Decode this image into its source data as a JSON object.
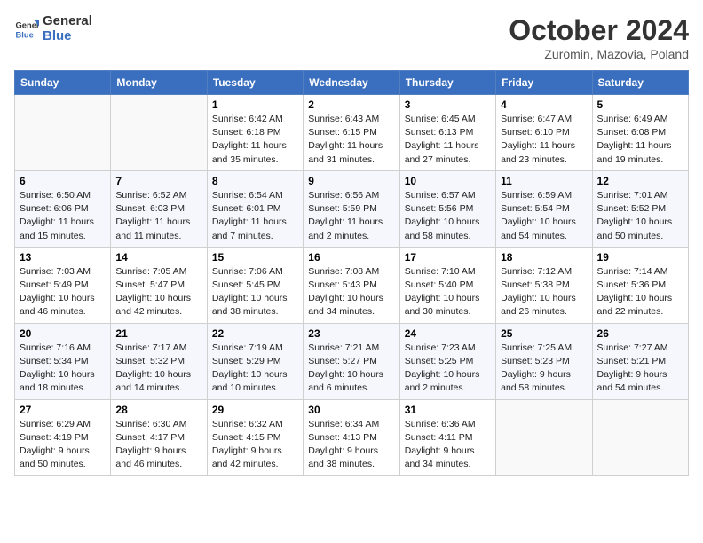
{
  "logo": {
    "line1": "General",
    "line2": "Blue"
  },
  "title": "October 2024",
  "location": "Zuromin, Mazovia, Poland",
  "headers": [
    "Sunday",
    "Monday",
    "Tuesday",
    "Wednesday",
    "Thursday",
    "Friday",
    "Saturday"
  ],
  "weeks": [
    [
      {
        "day": "",
        "info": ""
      },
      {
        "day": "",
        "info": ""
      },
      {
        "day": "1",
        "info": "Sunrise: 6:42 AM\nSunset: 6:18 PM\nDaylight: 11 hours and 35 minutes."
      },
      {
        "day": "2",
        "info": "Sunrise: 6:43 AM\nSunset: 6:15 PM\nDaylight: 11 hours and 31 minutes."
      },
      {
        "day": "3",
        "info": "Sunrise: 6:45 AM\nSunset: 6:13 PM\nDaylight: 11 hours and 27 minutes."
      },
      {
        "day": "4",
        "info": "Sunrise: 6:47 AM\nSunset: 6:10 PM\nDaylight: 11 hours and 23 minutes."
      },
      {
        "day": "5",
        "info": "Sunrise: 6:49 AM\nSunset: 6:08 PM\nDaylight: 11 hours and 19 minutes."
      }
    ],
    [
      {
        "day": "6",
        "info": "Sunrise: 6:50 AM\nSunset: 6:06 PM\nDaylight: 11 hours and 15 minutes."
      },
      {
        "day": "7",
        "info": "Sunrise: 6:52 AM\nSunset: 6:03 PM\nDaylight: 11 hours and 11 minutes."
      },
      {
        "day": "8",
        "info": "Sunrise: 6:54 AM\nSunset: 6:01 PM\nDaylight: 11 hours and 7 minutes."
      },
      {
        "day": "9",
        "info": "Sunrise: 6:56 AM\nSunset: 5:59 PM\nDaylight: 11 hours and 2 minutes."
      },
      {
        "day": "10",
        "info": "Sunrise: 6:57 AM\nSunset: 5:56 PM\nDaylight: 10 hours and 58 minutes."
      },
      {
        "day": "11",
        "info": "Sunrise: 6:59 AM\nSunset: 5:54 PM\nDaylight: 10 hours and 54 minutes."
      },
      {
        "day": "12",
        "info": "Sunrise: 7:01 AM\nSunset: 5:52 PM\nDaylight: 10 hours and 50 minutes."
      }
    ],
    [
      {
        "day": "13",
        "info": "Sunrise: 7:03 AM\nSunset: 5:49 PM\nDaylight: 10 hours and 46 minutes."
      },
      {
        "day": "14",
        "info": "Sunrise: 7:05 AM\nSunset: 5:47 PM\nDaylight: 10 hours and 42 minutes."
      },
      {
        "day": "15",
        "info": "Sunrise: 7:06 AM\nSunset: 5:45 PM\nDaylight: 10 hours and 38 minutes."
      },
      {
        "day": "16",
        "info": "Sunrise: 7:08 AM\nSunset: 5:43 PM\nDaylight: 10 hours and 34 minutes."
      },
      {
        "day": "17",
        "info": "Sunrise: 7:10 AM\nSunset: 5:40 PM\nDaylight: 10 hours and 30 minutes."
      },
      {
        "day": "18",
        "info": "Sunrise: 7:12 AM\nSunset: 5:38 PM\nDaylight: 10 hours and 26 minutes."
      },
      {
        "day": "19",
        "info": "Sunrise: 7:14 AM\nSunset: 5:36 PM\nDaylight: 10 hours and 22 minutes."
      }
    ],
    [
      {
        "day": "20",
        "info": "Sunrise: 7:16 AM\nSunset: 5:34 PM\nDaylight: 10 hours and 18 minutes."
      },
      {
        "day": "21",
        "info": "Sunrise: 7:17 AM\nSunset: 5:32 PM\nDaylight: 10 hours and 14 minutes."
      },
      {
        "day": "22",
        "info": "Sunrise: 7:19 AM\nSunset: 5:29 PM\nDaylight: 10 hours and 10 minutes."
      },
      {
        "day": "23",
        "info": "Sunrise: 7:21 AM\nSunset: 5:27 PM\nDaylight: 10 hours and 6 minutes."
      },
      {
        "day": "24",
        "info": "Sunrise: 7:23 AM\nSunset: 5:25 PM\nDaylight: 10 hours and 2 minutes."
      },
      {
        "day": "25",
        "info": "Sunrise: 7:25 AM\nSunset: 5:23 PM\nDaylight: 9 hours and 58 minutes."
      },
      {
        "day": "26",
        "info": "Sunrise: 7:27 AM\nSunset: 5:21 PM\nDaylight: 9 hours and 54 minutes."
      }
    ],
    [
      {
        "day": "27",
        "info": "Sunrise: 6:29 AM\nSunset: 4:19 PM\nDaylight: 9 hours and 50 minutes."
      },
      {
        "day": "28",
        "info": "Sunrise: 6:30 AM\nSunset: 4:17 PM\nDaylight: 9 hours and 46 minutes."
      },
      {
        "day": "29",
        "info": "Sunrise: 6:32 AM\nSunset: 4:15 PM\nDaylight: 9 hours and 42 minutes."
      },
      {
        "day": "30",
        "info": "Sunrise: 6:34 AM\nSunset: 4:13 PM\nDaylight: 9 hours and 38 minutes."
      },
      {
        "day": "31",
        "info": "Sunrise: 6:36 AM\nSunset: 4:11 PM\nDaylight: 9 hours and 34 minutes."
      },
      {
        "day": "",
        "info": ""
      },
      {
        "day": "",
        "info": ""
      }
    ]
  ]
}
